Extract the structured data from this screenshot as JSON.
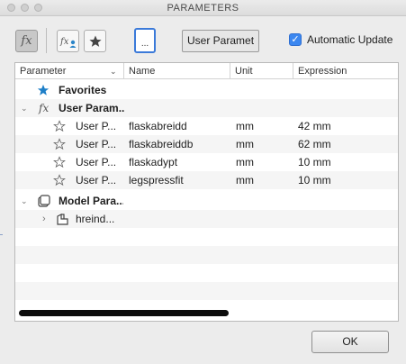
{
  "window": {
    "title": "PARAMETERS"
  },
  "toolbar": {
    "fx_label": "fx",
    "user_param_combo": "User Paramet",
    "ellipsis": "...",
    "automatic_update_label": "Automatic Update",
    "automatic_update_checked": true
  },
  "table": {
    "columns": [
      "Parameter",
      "Name",
      "Unit",
      "Expression"
    ],
    "favorites_label": "Favorites",
    "user_params_group": "User Param...",
    "user_params": [
      {
        "parameter": "User P...",
        "name": "flaskabreidd",
        "unit": "mm",
        "expression": "42 mm"
      },
      {
        "parameter": "User P...",
        "name": "flaskabreiddb",
        "unit": "mm",
        "expression": "62 mm"
      },
      {
        "parameter": "User P...",
        "name": "flaskadypt",
        "unit": "mm",
        "expression": "10 mm"
      },
      {
        "parameter": "User P...",
        "name": "legspressfit",
        "unit": "mm",
        "expression": "10 mm"
      }
    ],
    "model_params_group": "Model Para...",
    "model_child": "hreind..."
  },
  "footer": {
    "ok_label": "OK"
  }
}
